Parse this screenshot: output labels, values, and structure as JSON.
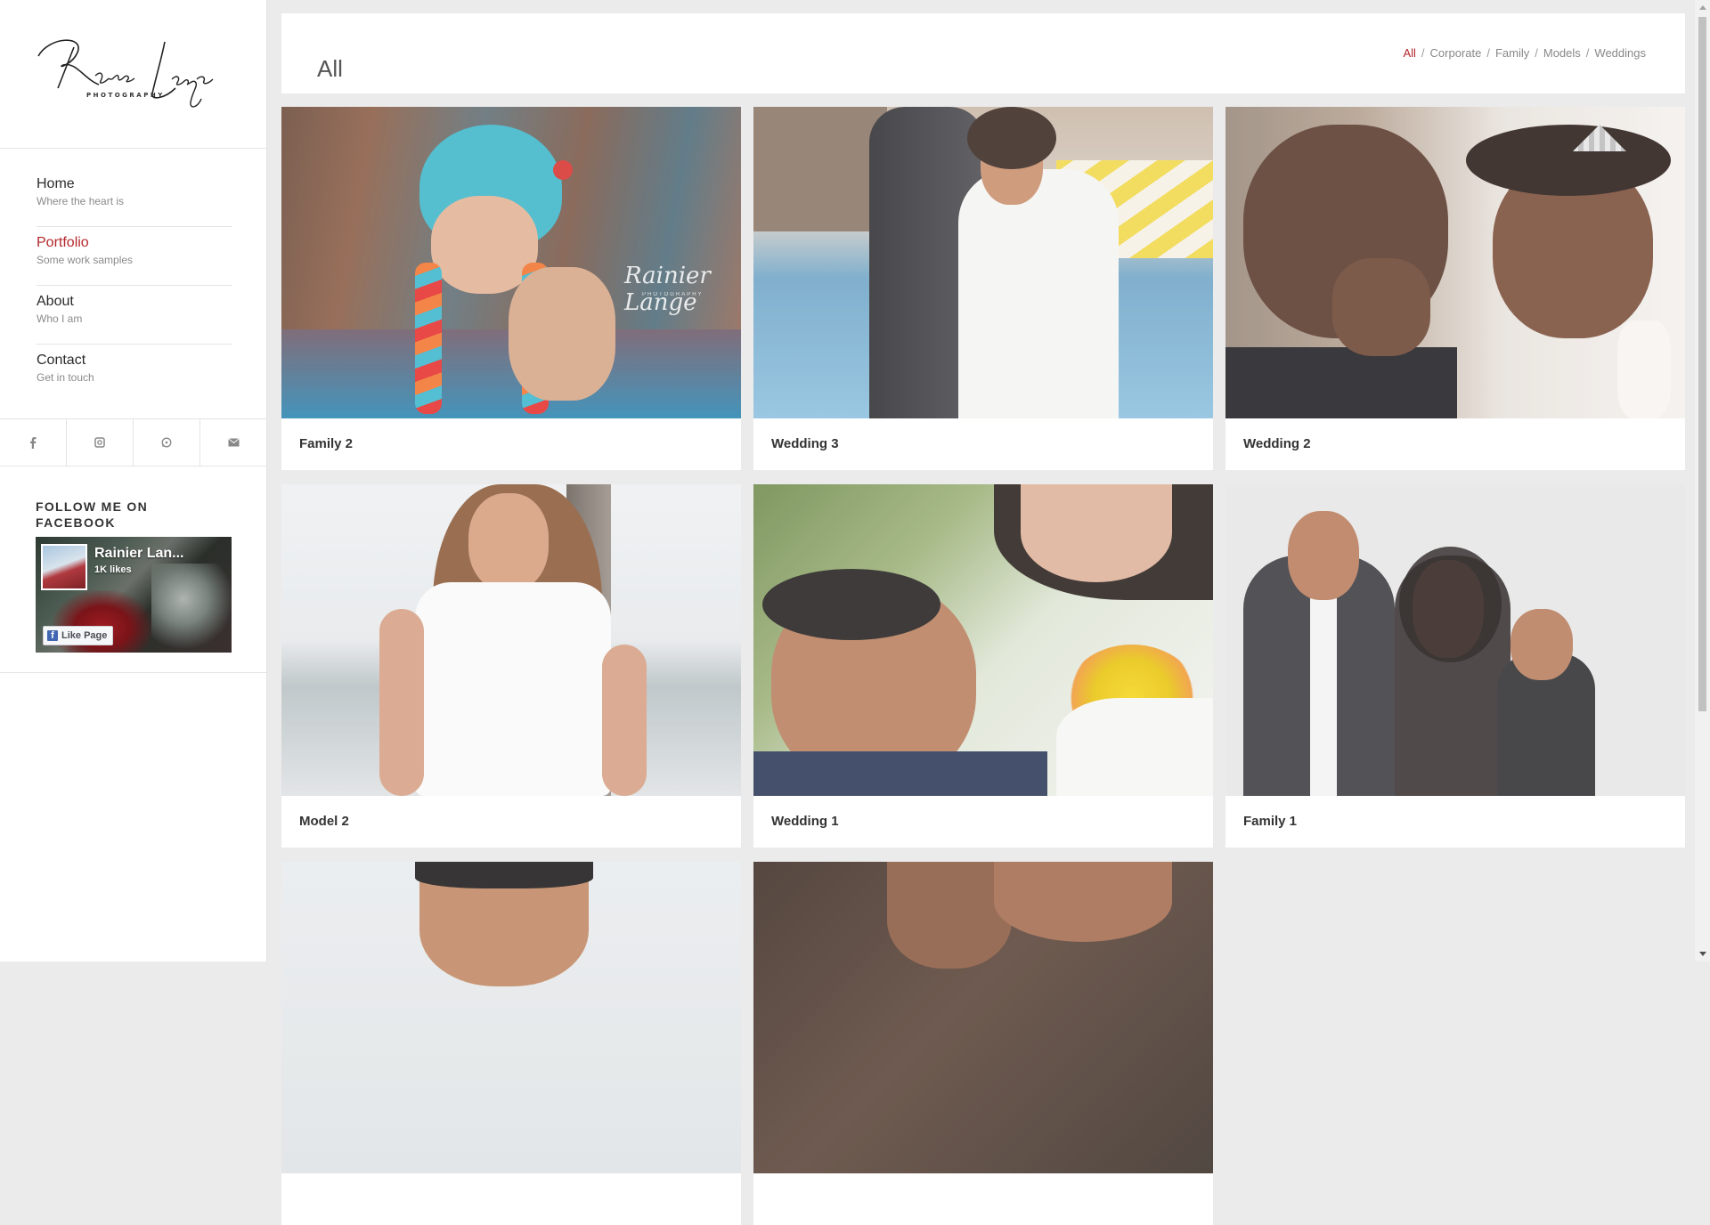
{
  "brand": {
    "logo_script": "Rainier Lange",
    "logo_sub": "PHOTOGRAPHY"
  },
  "menu": [
    {
      "title": "Home",
      "subtitle": "Where the heart is",
      "active": false
    },
    {
      "title": "Portfolio",
      "subtitle": "Some work samples",
      "active": true
    },
    {
      "title": "About",
      "subtitle": "Who I am",
      "active": false
    },
    {
      "title": "Contact",
      "subtitle": "Get in touch",
      "active": false
    }
  ],
  "socials": [
    "facebook-icon",
    "instagram-icon",
    "whatsapp-icon",
    "mail-icon"
  ],
  "facebook_widget": {
    "heading": "FOLLOW ME ON FACEBOOK",
    "page_name": "Rainier Lan...",
    "likes": "1K likes",
    "like_button": "Like Page"
  },
  "header": {
    "title": "All",
    "filters": [
      "All",
      "Corporate",
      "Family",
      "Models",
      "Weddings"
    ],
    "separator": "/",
    "active_filter": "All"
  },
  "portfolio": [
    {
      "caption": "Family 2",
      "watermark": "Rainier Lange",
      "watermark_sub": "PHOTOGRAPHY"
    },
    {
      "caption": "Wedding 3"
    },
    {
      "caption": "Wedding 2"
    },
    {
      "caption": "Model 2"
    },
    {
      "caption": "Wedding 1"
    },
    {
      "caption": "Family 1"
    },
    {
      "caption": ""
    },
    {
      "caption": ""
    }
  ],
  "colors": {
    "accent": "#b3262b",
    "page_bg": "#ebebeb",
    "facebook_blue": "#4267b2"
  }
}
